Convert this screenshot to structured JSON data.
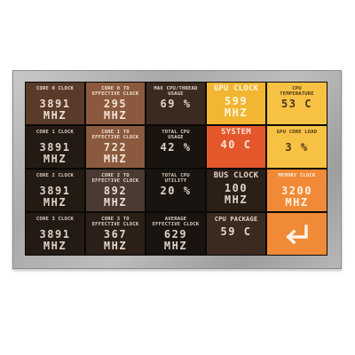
{
  "tiles": [
    {
      "label": "CORE 0 CLOCK",
      "value": "3891\nMHZ"
    },
    {
      "label": "CORE 0 TO\nEFFECTIVE CLOCK",
      "value": "295\nMHZ"
    },
    {
      "label": "MAX CPU/THREAD\nUSAGE",
      "value": "69 %"
    },
    {
      "label": "GPU CLOCK",
      "value": "599\nMHZ"
    },
    {
      "label": "CPU\nTEMPERATURE",
      "value": "53 C"
    },
    {
      "label": "CORE 1 CLOCK",
      "value": "3891\nMHZ"
    },
    {
      "label": "CORE 1 TO\nEFFECTIVE CLOCK",
      "value": "722\nMHZ"
    },
    {
      "label": "TOTAL CPU\nUSAGE",
      "value": "42 %"
    },
    {
      "label": "SYSTEM",
      "value": "40 C"
    },
    {
      "label": "GPU CORE LOAD",
      "value": "3 %"
    },
    {
      "label": "CORE 2 CLOCK",
      "value": "3891\nMHZ"
    },
    {
      "label": "CORE 2 TO\nEFFECTIVE CLOCK",
      "value": "892\nMHZ"
    },
    {
      "label": "TOTAL CPU\nUTILITY",
      "value": "20 %"
    },
    {
      "label": "BUS CLOCK",
      "value": "100\nMHZ"
    },
    {
      "label": "MEMORY CLOCK",
      "value": "3200\nMHZ"
    },
    {
      "label": "CORE 3 CLOCK",
      "value": "3891\nMHZ"
    },
    {
      "label": "CORE 3 TO\nEFFECTIVE CLOCK",
      "value": "367\nMHZ"
    },
    {
      "label": "AVERAGE\nEFFECTIVE CLOCK",
      "value": "629\nMHZ"
    },
    {
      "label": "CPU PACKAGE",
      "value": "59 C"
    }
  ],
  "back_button": {
    "icon": "return-arrow-icon"
  },
  "colors": {
    "bezel": "#b0b0b0",
    "screen": "#191511",
    "gold": "#f2b632",
    "orange": "#e3572a",
    "amber": "#f08a36",
    "brown": "#8b5a3e"
  }
}
